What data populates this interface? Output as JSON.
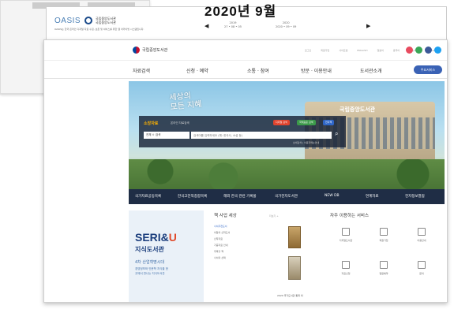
{
  "background": {
    "oasis_logo": "OASIS",
    "oasis_org_line1": "국립중앙도서관",
    "oasis_org_line2": "국립중앙도서관",
    "oasis_desc": "OASIS는 한국 온라인 디지털 자료 수집, 보존 및 서비스를 위한 웹 아카이빙 시스템입니다.",
    "month_title": "2020년 9월",
    "prev_arrow": "◀",
    "next_arrow": "▶",
    "dates": [
      {
        "year": "2019",
        "date": "27 • 08 • 05"
      },
      {
        "year": "2020",
        "date": "2020 • 09 • 09"
      }
    ]
  },
  "site": {
    "logo_text": "국립중앙도서관",
    "util_links": [
      "로그인",
      "회원가입",
      "사이트맵",
      "ENGLISH",
      "일본어",
      "중국어",
      "English",
      "Chinese"
    ],
    "sns_colors": [
      "#e84b5f",
      "#3aa757",
      "#3b5998",
      "#1da1f2"
    ],
    "gnb": [
      "자료검색",
      "신청 · 예약",
      "소통 · 참여",
      "방문 · 이용안내",
      "도서관소개"
    ],
    "gnb_button": "주요서비스",
    "hero": {
      "calligraphy_line1": "세상의",
      "calligraphy_line2": "모든 지혜",
      "building_sign": "국립중앙도서관"
    },
    "search": {
      "label": "소장자료",
      "sub_label": "온라인 자료검색",
      "chips": [
        {
          "label": "디지털 검색",
          "color": "#e0442e"
        },
        {
          "label": "국제표준 검색",
          "color": "#3c9a4a"
        },
        {
          "label": "전자책",
          "color": "#2f66c7"
        }
      ],
      "select_value": "전체 ㅇ 검색",
      "placeholder": "검색어를 입력하세요 (예: 한국사, 소설 등)",
      "links": "상세검색 | 이용자메뉴안내"
    },
    "services": [
      "국가자료공동목록",
      "한국고전적종합목록",
      "해외 한국 관련 기록물",
      "국가전자도서관",
      "NEW DB",
      "연계자료",
      "전자정보열람"
    ],
    "seri": {
      "logo": "SERI&",
      "logo_g": "U",
      "subtitle": "지식도서관",
      "line1": "4차 산업혁명시대",
      "line2": "경영정보와 인문학 지식을 한",
      "line3": "곳에서 만나는 지식도서관"
    },
    "news": {
      "title": "책 사업 세상",
      "more": "더보기 +",
      "items": [
        "사서추천도서",
        "이달의 신착도서",
        "신착자료",
        "기증자료 안내",
        "주목할 책",
        "사서의 선택"
      ]
    },
    "book_caption": "2020 국가도서관 통계 외",
    "frequent": {
      "title": "자주 이용하는 서비스",
      "items": [
        "디지털도서관",
        "회원가입",
        "이용안내",
        "자료신청",
        "열람예약",
        "문의"
      ]
    }
  }
}
